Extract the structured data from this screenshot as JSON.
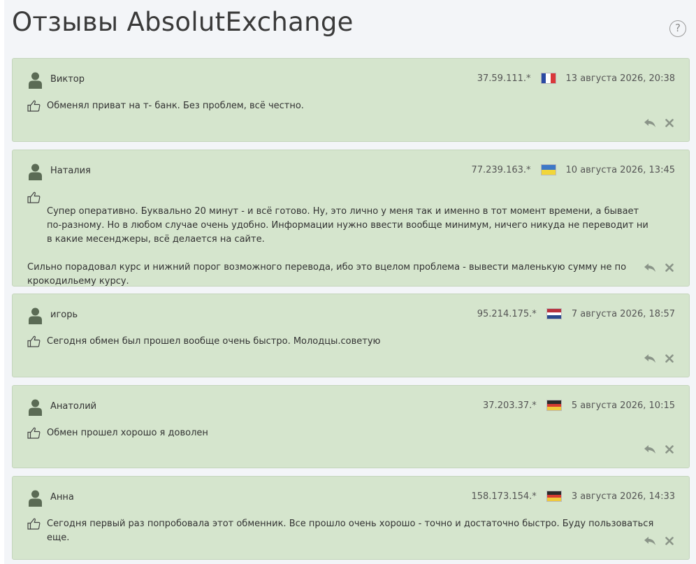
{
  "page": {
    "title": "Отзывы AbsolutExchange",
    "help_label": "?"
  },
  "reviews": [
    {
      "author": "Виктор",
      "ip": "37.59.111.*",
      "flag": "france",
      "date": "13 августа 2026, 20:38",
      "text": "Обменял приват на т- банк. Без проблем, всё честно."
    },
    {
      "author": "Наталия",
      "ip": "77.239.163.*",
      "flag": "ukraine",
      "date": "10 августа 2026, 13:45",
      "text": "Супер оперативно. Буквально 20 минут - и всё готово. Ну, это лично у меня так и именно в тот момент времени, а бывает по-разному. Но в любом случае очень удобно. Информации нужно ввести вообще минимум, ничего никуда не переводит ни в какие месенджеры, всё делается на сайте.",
      "text2": "Сильно порадовал курс и нижний порог возможного перевода, ибо это вцелом проблема - вывести маленькую сумму не по крокодильему курсу."
    },
    {
      "author": "игорь",
      "ip": "95.214.175.*",
      "flag": "netherlands",
      "date": "7 августа 2026, 18:57",
      "text": "Сегодня обмен был прошел вообще очень быстро. Молодцы.советую"
    },
    {
      "author": "Анатолий",
      "ip": "37.203.37.*",
      "flag": "germany",
      "date": "5 августа 2026, 10:15",
      "text": "Обмен прошел хорошо я доволен"
    },
    {
      "author": "Анна",
      "ip": "158.173.154.*",
      "flag": "germany",
      "date": "3 августа 2026, 14:33",
      "text": "Сегодня первый раз попробовала этот обменник. Все прошло очень хорошо - точно и достаточно быстро. Буду пользоваться еще."
    }
  ],
  "colors": {
    "card_bg": "#d5e5cd",
    "card_border": "#c4d5bc",
    "icon": "#5b6b55",
    "action_icon": "#8a9488"
  },
  "icons": {
    "avatar": "user-silhouette-icon",
    "thumb": "thumbs-up-icon",
    "reply": "reply-icon",
    "delete": "close-icon",
    "help": "help-icon"
  }
}
